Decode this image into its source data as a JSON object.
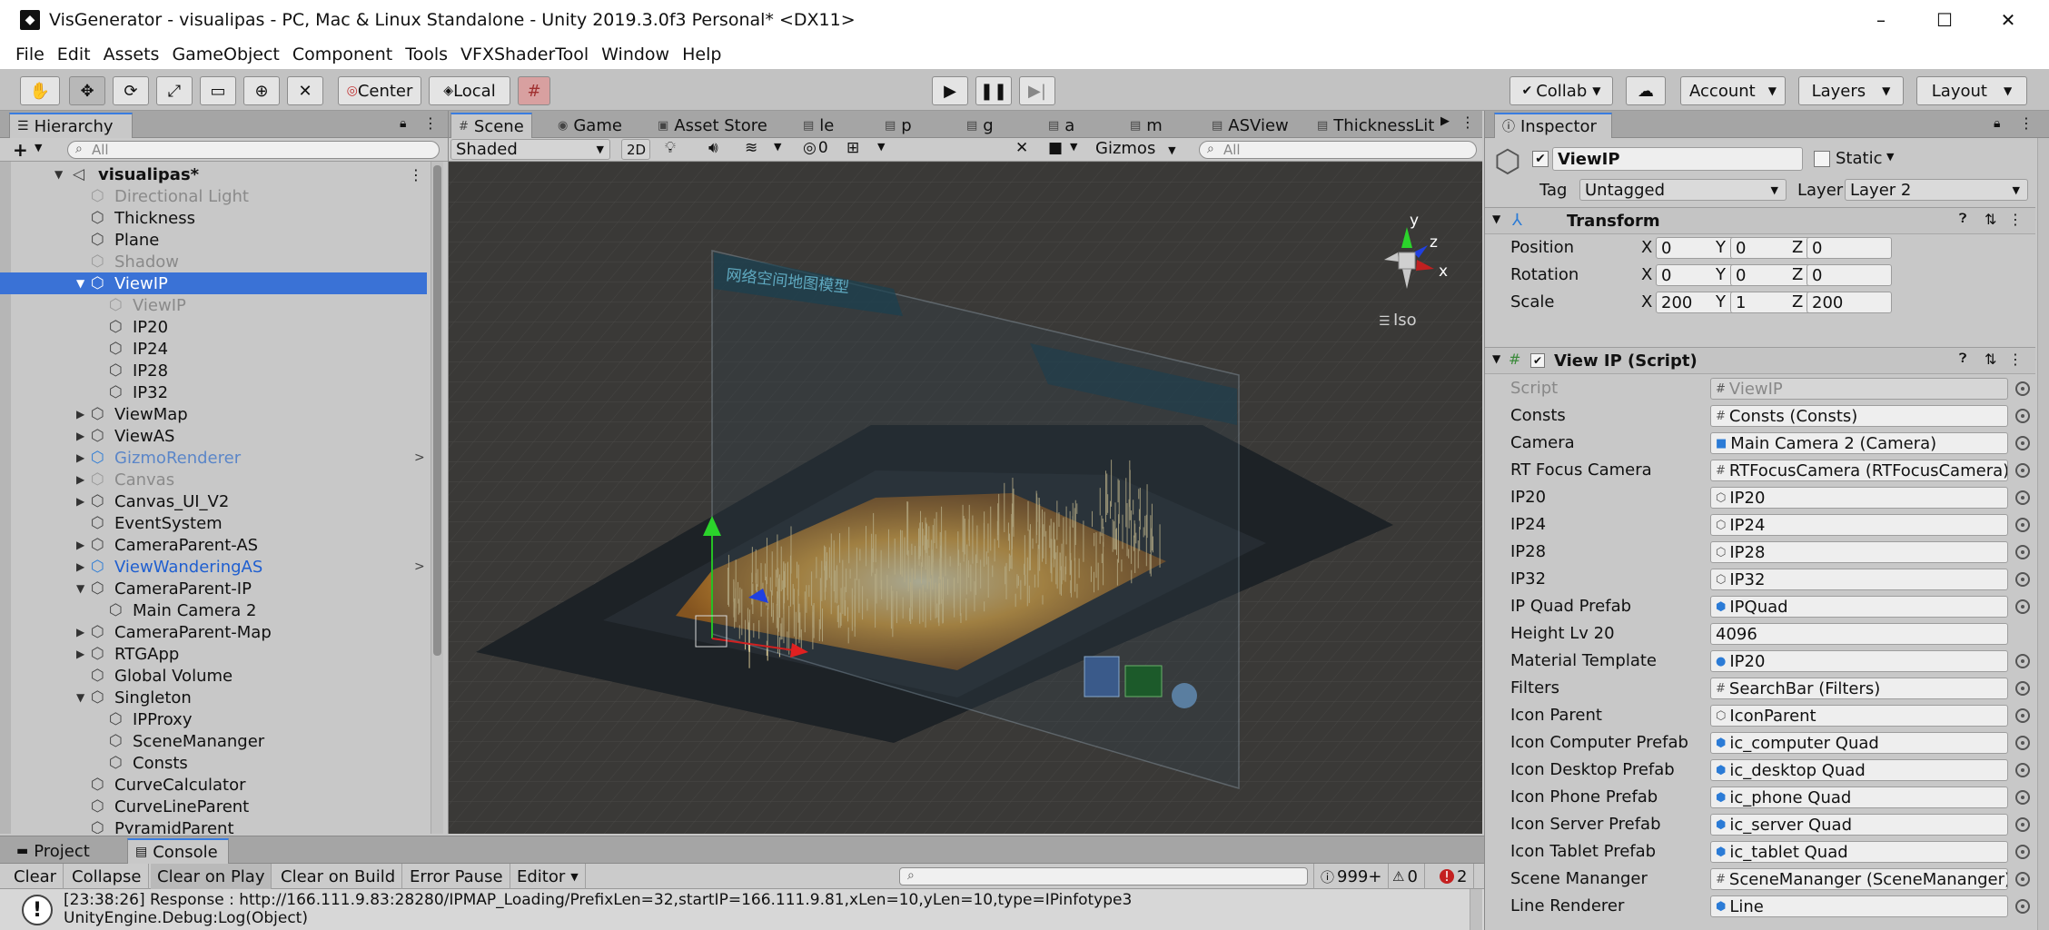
{
  "window": {
    "title": "VisGenerator - visualipas - PC, Mac & Linux Standalone - Unity 2019.3.0f3 Personal* <DX11>",
    "controls": [
      "minimize-icon",
      "maximize-icon",
      "close-icon"
    ]
  },
  "menu": [
    "File",
    "Edit",
    "Assets",
    "GameObject",
    "Component",
    "Tools",
    "VFXShaderTool",
    "Window",
    "Help"
  ],
  "toolbar": {
    "tools": [
      "hand-tool-icon",
      "move-tool-icon",
      "rotate-tool-icon",
      "scale-tool-icon",
      "rect-tool-icon",
      "transform-tool-icon",
      "custom-tool-icon"
    ],
    "pivot_label": "Center",
    "space_label": "Local",
    "collab_label": "Collab",
    "account_label": "Account",
    "layers_label": "Layers",
    "layout_label": "Layout"
  },
  "hierarchy": {
    "tab": "Hierarchy",
    "search_placeholder": "All",
    "scene_name": "visualipas*",
    "items": [
      {
        "label": "Directional Light",
        "depth": 1,
        "state": "dim",
        "arrow": ""
      },
      {
        "label": "Thickness",
        "depth": 1,
        "state": "",
        "arrow": ""
      },
      {
        "label": "Plane",
        "depth": 1,
        "state": "",
        "arrow": ""
      },
      {
        "label": "Shadow",
        "depth": 1,
        "state": "dim",
        "arrow": ""
      },
      {
        "label": "ViewIP",
        "depth": 1,
        "state": "selected",
        "arrow": "▼"
      },
      {
        "label": "ViewIP",
        "depth": 2,
        "state": "dim",
        "arrow": ""
      },
      {
        "label": "IP20",
        "depth": 2,
        "state": "",
        "arrow": ""
      },
      {
        "label": "IP24",
        "depth": 2,
        "state": "",
        "arrow": ""
      },
      {
        "label": "IP28",
        "depth": 2,
        "state": "",
        "arrow": ""
      },
      {
        "label": "IP32",
        "depth": 2,
        "state": "",
        "arrow": ""
      },
      {
        "label": "ViewMap",
        "depth": 1,
        "state": "",
        "arrow": "▶"
      },
      {
        "label": "ViewAS",
        "depth": 1,
        "state": "",
        "arrow": "▶"
      },
      {
        "label": "GizmoRenderer",
        "depth": 1,
        "state": "prefab-dim",
        "arrow": "▶"
      },
      {
        "label": "Canvas",
        "depth": 1,
        "state": "dim",
        "arrow": "▶"
      },
      {
        "label": "Canvas_UI_V2",
        "depth": 1,
        "state": "",
        "arrow": "▶"
      },
      {
        "label": "EventSystem",
        "depth": 1,
        "state": "",
        "arrow": ""
      },
      {
        "label": "CameraParent-AS",
        "depth": 1,
        "state": "",
        "arrow": "▶"
      },
      {
        "label": "ViewWanderingAS",
        "depth": 1,
        "state": "prefab",
        "arrow": "▶"
      },
      {
        "label": "CameraParent-IP",
        "depth": 1,
        "state": "",
        "arrow": "▼"
      },
      {
        "label": "Main Camera 2",
        "depth": 2,
        "state": "",
        "arrow": ""
      },
      {
        "label": "CameraParent-Map",
        "depth": 1,
        "state": "",
        "arrow": "▶"
      },
      {
        "label": "RTGApp",
        "depth": 1,
        "state": "",
        "arrow": "▶"
      },
      {
        "label": "Global Volume",
        "depth": 1,
        "state": "",
        "arrow": ""
      },
      {
        "label": "Singleton",
        "depth": 1,
        "state": "",
        "arrow": "▼"
      },
      {
        "label": "IPProxy",
        "depth": 2,
        "state": "",
        "arrow": ""
      },
      {
        "label": "SceneMananger",
        "depth": 2,
        "state": "",
        "arrow": ""
      },
      {
        "label": "Consts",
        "depth": 2,
        "state": "",
        "arrow": ""
      },
      {
        "label": "CurveCalculator",
        "depth": 1,
        "state": "",
        "arrow": ""
      },
      {
        "label": "CurveLineParent",
        "depth": 1,
        "state": "",
        "arrow": ""
      },
      {
        "label": "PyramidParent",
        "depth": 1,
        "state": "",
        "arrow": ""
      }
    ]
  },
  "scene": {
    "tabs": [
      {
        "label": "Scene",
        "icon": "scene-tab-icon"
      },
      {
        "label": "Game",
        "icon": "game-tab-icon"
      },
      {
        "label": "Asset Store",
        "icon": "asset-store-tab-icon"
      },
      {
        "label": "le",
        "icon": "window-tab-icon"
      },
      {
        "label": "p",
        "icon": "window-tab-icon"
      },
      {
        "label": "g",
        "icon": "window-tab-icon"
      },
      {
        "label": "a",
        "icon": "window-tab-icon"
      },
      {
        "label": "m",
        "icon": "window-tab-icon"
      },
      {
        "label": "ASView",
        "icon": "window-tab-icon"
      },
      {
        "label": "ThicknessLit",
        "icon": "window-tab-icon"
      }
    ],
    "shading_mode": "Shaded",
    "mode_2d": "2D",
    "hidden_count": "0",
    "gizmos_label": "Gizmos",
    "search_placeholder": "All",
    "iso_label": "Iso",
    "axis_y": "y",
    "axis_x": "x",
    "axis_z": "z",
    "panel_caption": "网络空间地图模型"
  },
  "inspector": {
    "tab": "Inspector",
    "object_name": "ViewIP",
    "static_label": "Static",
    "tag_label": "Tag",
    "tag_value": "Untagged",
    "layer_label": "Layer",
    "layer_value": "Layer 2",
    "transform": {
      "title": "Transform",
      "position": {
        "label": "Position",
        "x": "0",
        "y": "0",
        "z": "0"
      },
      "rotation": {
        "label": "Rotation",
        "x": "0",
        "y": "0",
        "z": "0"
      },
      "scale": {
        "label": "Scale",
        "x": "200",
        "y": "1",
        "z": "200"
      }
    },
    "script_component": {
      "title": "View IP (Script)",
      "fields": [
        {
          "label": "Script",
          "value": "ViewIP",
          "icon": "script-icon",
          "dim": true
        },
        {
          "label": "Consts",
          "value": "Consts (Consts)",
          "icon": "script-icon"
        },
        {
          "label": "Camera",
          "value": "Main Camera 2 (Camera)",
          "icon": "camera-icon"
        },
        {
          "label": "RT Focus Camera",
          "value": "RTFocusCamera (RTFocusCamera)",
          "icon": "script-icon"
        },
        {
          "label": "IP20",
          "value": "IP20",
          "icon": "gameobject-icon"
        },
        {
          "label": "IP24",
          "value": "IP24",
          "icon": "gameobject-icon"
        },
        {
          "label": "IP28",
          "value": "IP28",
          "icon": "gameobject-icon"
        },
        {
          "label": "IP32",
          "value": "IP32",
          "icon": "gameobject-icon"
        },
        {
          "label": "IP Quad Prefab",
          "value": "IPQuad",
          "icon": "prefab-icon"
        },
        {
          "label": "Height Lv 20",
          "value": "4096",
          "icon": ""
        },
        {
          "label": "Material Template",
          "value": "IP20",
          "icon": "material-icon"
        },
        {
          "label": "Filters",
          "value": "SearchBar (Filters)",
          "icon": "script-icon"
        },
        {
          "label": "Icon Parent",
          "value": "IconParent",
          "icon": "gameobject-icon"
        },
        {
          "label": "Icon Computer Prefab",
          "value": "ic_computer Quad",
          "icon": "prefab-icon"
        },
        {
          "label": "Icon Desktop Prefab",
          "value": "ic_desktop Quad",
          "icon": "prefab-icon"
        },
        {
          "label": "Icon Phone Prefab",
          "value": "ic_phone Quad",
          "icon": "prefab-icon"
        },
        {
          "label": "Icon Server Prefab",
          "value": "ic_server Quad",
          "icon": "prefab-icon"
        },
        {
          "label": "Icon Tablet Prefab",
          "value": "ic_tablet Quad",
          "icon": "prefab-icon"
        },
        {
          "label": "Scene Mananger",
          "value": "SceneMananger (SceneMananger)",
          "icon": "script-icon"
        },
        {
          "label": "Line Renderer",
          "value": "Line",
          "icon": "prefab-icon"
        }
      ]
    }
  },
  "console": {
    "tabs": [
      "Project",
      "Console"
    ],
    "buttons": [
      "Clear",
      "Collapse",
      "Clear on Play",
      "Clear on Build",
      "Error Pause",
      "Editor"
    ],
    "log_count": "999+",
    "warning_count": "0",
    "error_count": "2",
    "log_line1": "[23:38:26] Response : http://166.111.9.83:28280/IPMAP_Loading/PrefixLen=32,startIP=166.111.9.81,xLen=10,yLen=10,type=IPinfotype3",
    "log_line2": "UnityEngine.Debug:Log(Object)"
  }
}
